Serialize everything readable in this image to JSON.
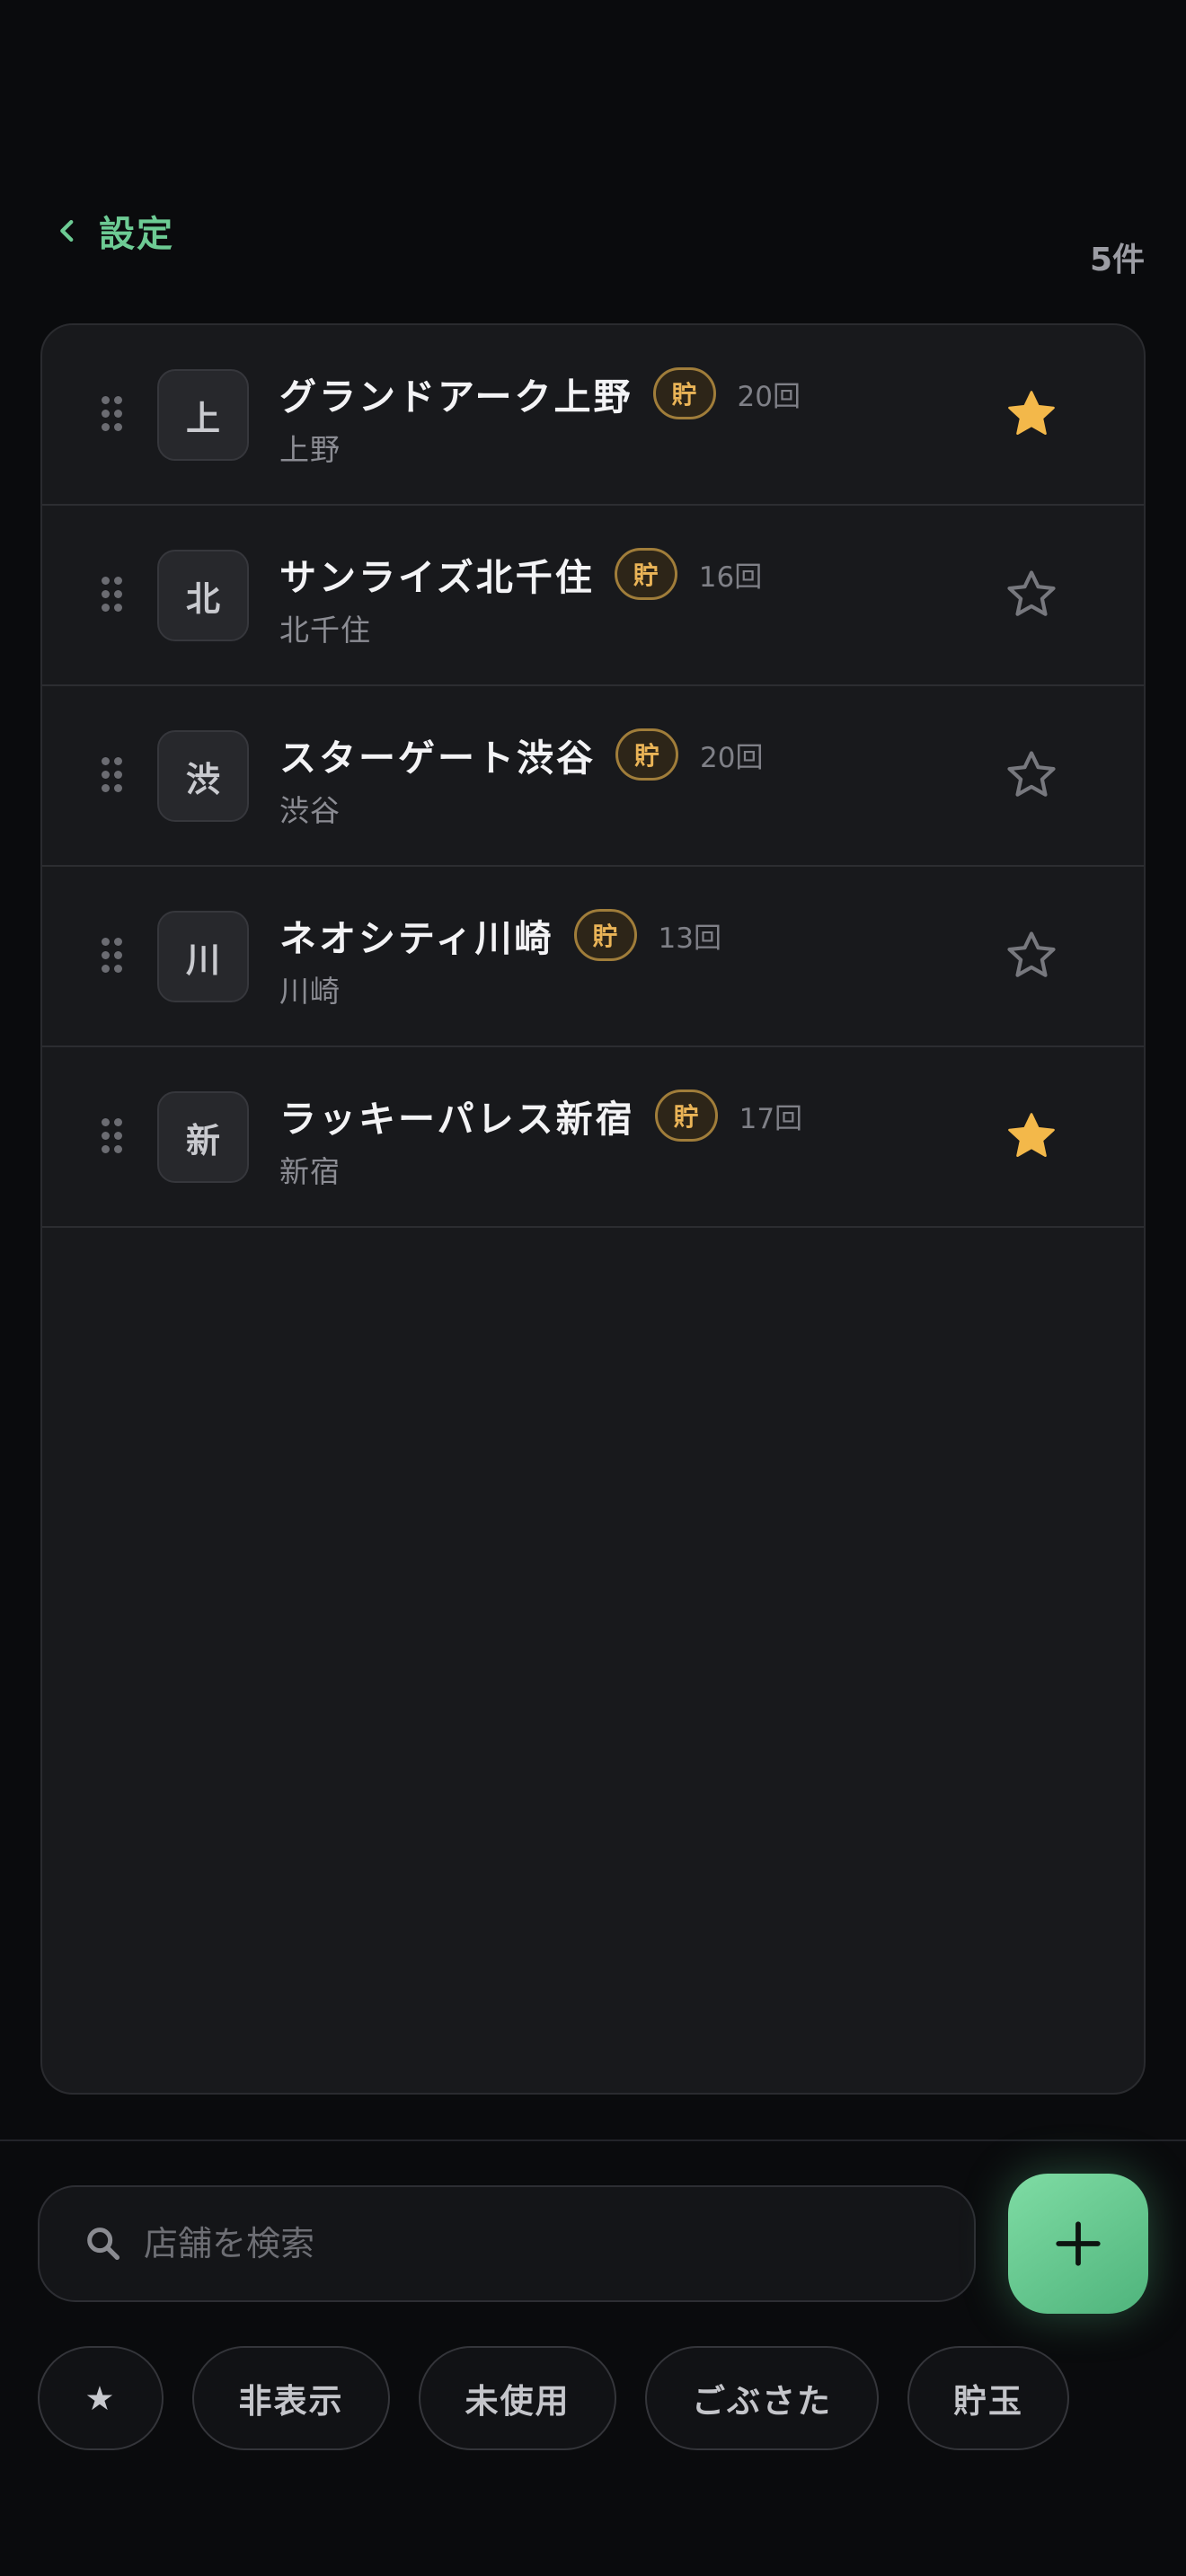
{
  "header": {
    "back_label": "設定",
    "count_label": "5件"
  },
  "stores": [
    {
      "initial": "上",
      "name": "グランドアーク上野",
      "badge": "貯",
      "visits": "20回",
      "area": "上野",
      "favorite": true
    },
    {
      "initial": "北",
      "name": "サンライズ北千住",
      "badge": "貯",
      "visits": "16回",
      "area": "北千住",
      "favorite": false
    },
    {
      "initial": "渋",
      "name": "スターゲート渋谷",
      "badge": "貯",
      "visits": "20回",
      "area": "渋谷",
      "favorite": false
    },
    {
      "initial": "川",
      "name": "ネオシティ川崎",
      "badge": "貯",
      "visits": "13回",
      "area": "川崎",
      "favorite": false
    },
    {
      "initial": "新",
      "name": "ラッキーパレス新宿",
      "badge": "貯",
      "visits": "17回",
      "area": "新宿",
      "favorite": true
    }
  ],
  "search": {
    "placeholder": "店舗を検索",
    "value": ""
  },
  "filters": [
    {
      "label": "★",
      "icon": "star-icon"
    },
    {
      "label": "非表示"
    },
    {
      "label": "未使用"
    },
    {
      "label": "ごぶさた"
    },
    {
      "label": "貯玉"
    }
  ],
  "colors": {
    "accent": "#6dcb94",
    "favorite_star": "#f3b84a",
    "badge_text": "#eab457",
    "background": "#0a0b0d",
    "card": "#18191c"
  }
}
